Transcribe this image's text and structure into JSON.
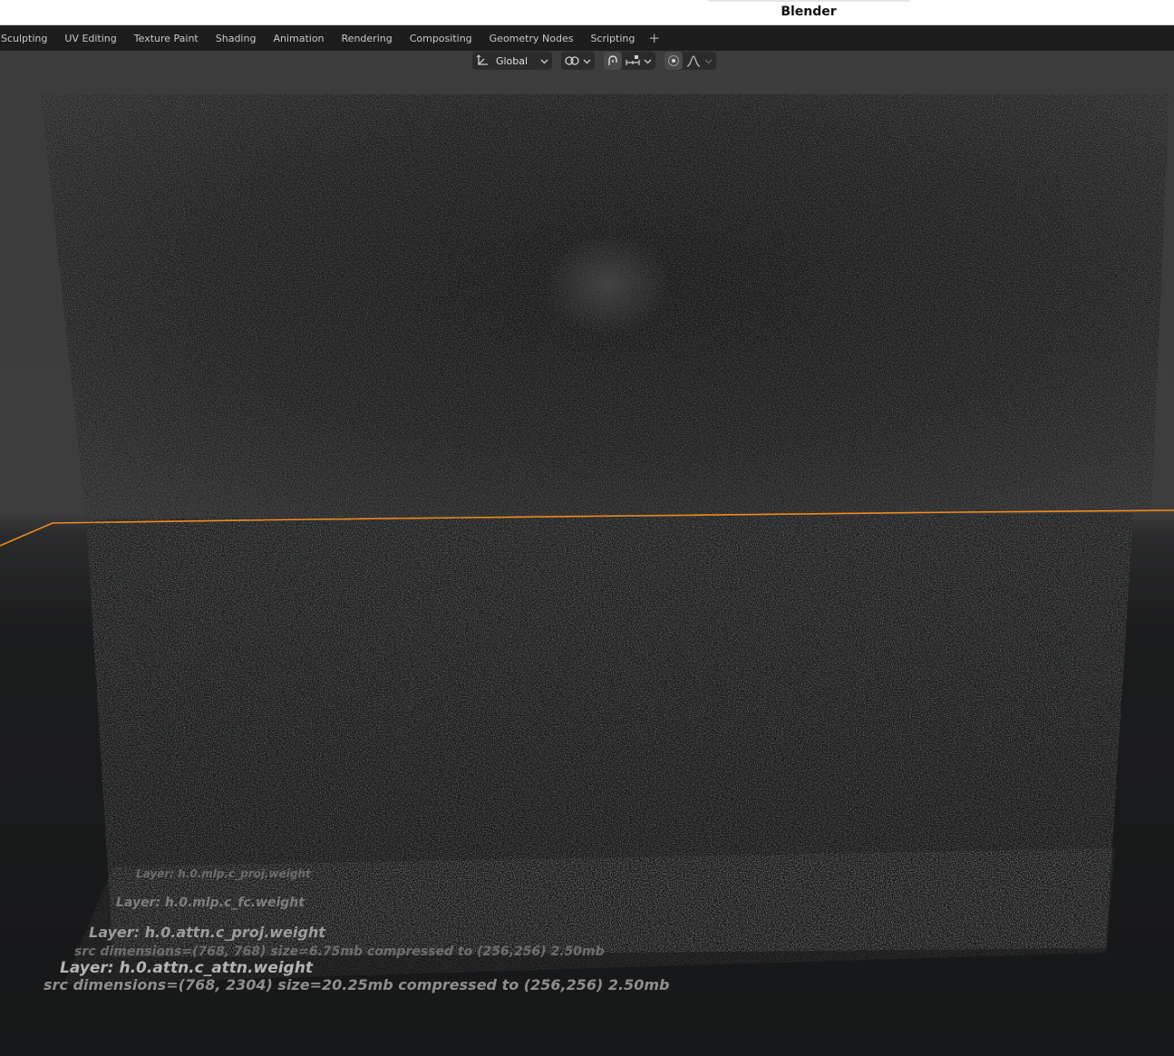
{
  "window": {
    "title": "Blender"
  },
  "workspaces": {
    "tabs": [
      {
        "label": "Sculpting"
      },
      {
        "label": "UV Editing"
      },
      {
        "label": "Texture Paint"
      },
      {
        "label": "Shading"
      },
      {
        "label": "Animation"
      },
      {
        "label": "Rendering"
      },
      {
        "label": "Compositing"
      },
      {
        "label": "Geometry Nodes"
      },
      {
        "label": "Scripting"
      }
    ],
    "add_label": "+"
  },
  "viewport_header": {
    "transform_orientation": "Global"
  },
  "scene_text": {
    "layer_1": "Layer: h.0.attn.c_attn.weight",
    "dims_1": "src dimensions=(768, 2304) size=20.25mb compressed to (256,256) 2.50mb",
    "layer_2": "Layer: h.0.attn.c_proj.weight",
    "dims_2": "src dimensions=(768, 768) size=6.75mb compressed to (256,256) 2.50mb",
    "layer_3": "Layer: h.0.mlp.c_fc.weight",
    "layer_4": "Layer: h.0.mlp.c_proj.weight"
  },
  "colors": {
    "selection_outline": "#f08a1c",
    "viewport_bg": "#3d3d3d",
    "floor_bg": "#1a1b1c"
  }
}
